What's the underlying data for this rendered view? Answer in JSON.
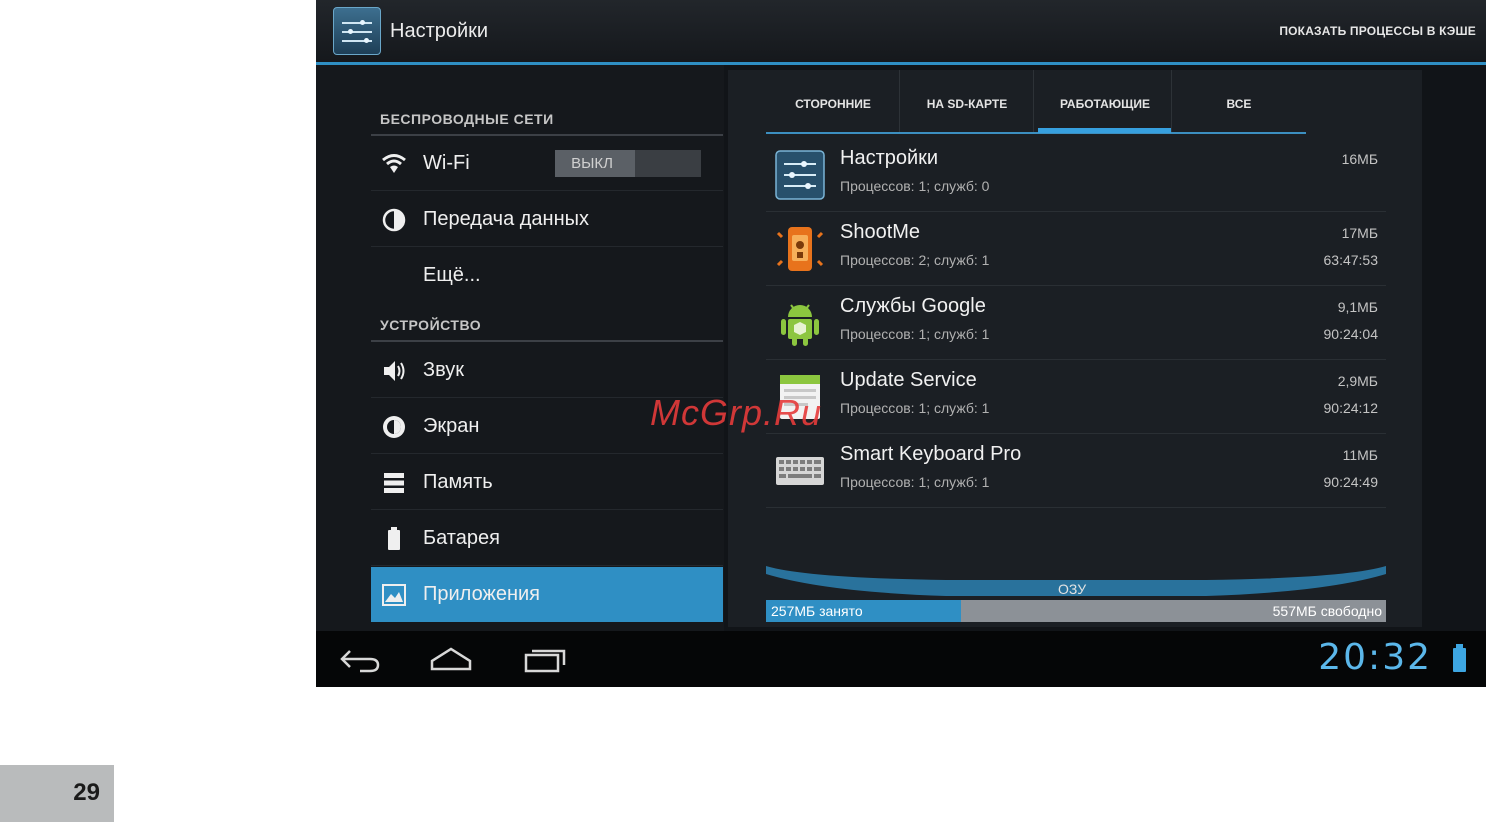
{
  "action_bar": {
    "title": "Настройки",
    "action": "ПОКАЗАТЬ ПРОЦЕССЫ В КЭШЕ"
  },
  "settings": {
    "wireless_header": "БЕСПРОВОДНЫЕ СЕТИ",
    "wifi": {
      "label": "Wi-Fi",
      "toggle": "ВЫКЛ"
    },
    "data_usage": "Передача данных",
    "more": "Ещё...",
    "device_header": "УСТРОЙСТВО",
    "sound": "Звук",
    "display": "Экран",
    "storage": "Память",
    "battery": "Батарея",
    "apps": "Приложения"
  },
  "tabs": [
    "СТОРОННИЕ",
    "НА SD-КАРТЕ",
    "РАБОТАЮЩИЕ",
    "ВСЕ"
  ],
  "active_tab": "РАБОТАЮЩИЕ",
  "apps": [
    {
      "name": "Настройки",
      "sub": "Процессов: 1; служб: 0",
      "size": "16МБ",
      "time": "",
      "icon": "settings-icon"
    },
    {
      "name": "ShootMe",
      "sub": "Процессов: 2; служб: 1",
      "size": "17МБ",
      "time": "63:47:53",
      "icon": "shootme-icon"
    },
    {
      "name": "Службы Google",
      "sub": "Процессов: 1; служб: 1",
      "size": "9,1МБ",
      "time": "90:24:04",
      "icon": "android-icon"
    },
    {
      "name": "Update Service",
      "sub": "Процессов: 1; служб: 1",
      "size": "2,9МБ",
      "time": "90:24:12",
      "icon": "update-service-icon"
    },
    {
      "name": "Smart Keyboard Pro",
      "sub": "Процессов: 1; служб: 1",
      "size": "11МБ",
      "time": "90:24:49",
      "icon": "keyboard-icon"
    }
  ],
  "ram": {
    "label": "ОЗУ",
    "used": "257МБ занято",
    "free": "557МБ свободно",
    "used_fraction": 0.315
  },
  "status": {
    "clock": "20:32"
  },
  "watermark": "McGrp.Ru",
  "page_number": "29",
  "colors": {
    "accent": "#2f8fc4",
    "clock": "#5bb7ea",
    "watermark": "#e53b3b"
  }
}
